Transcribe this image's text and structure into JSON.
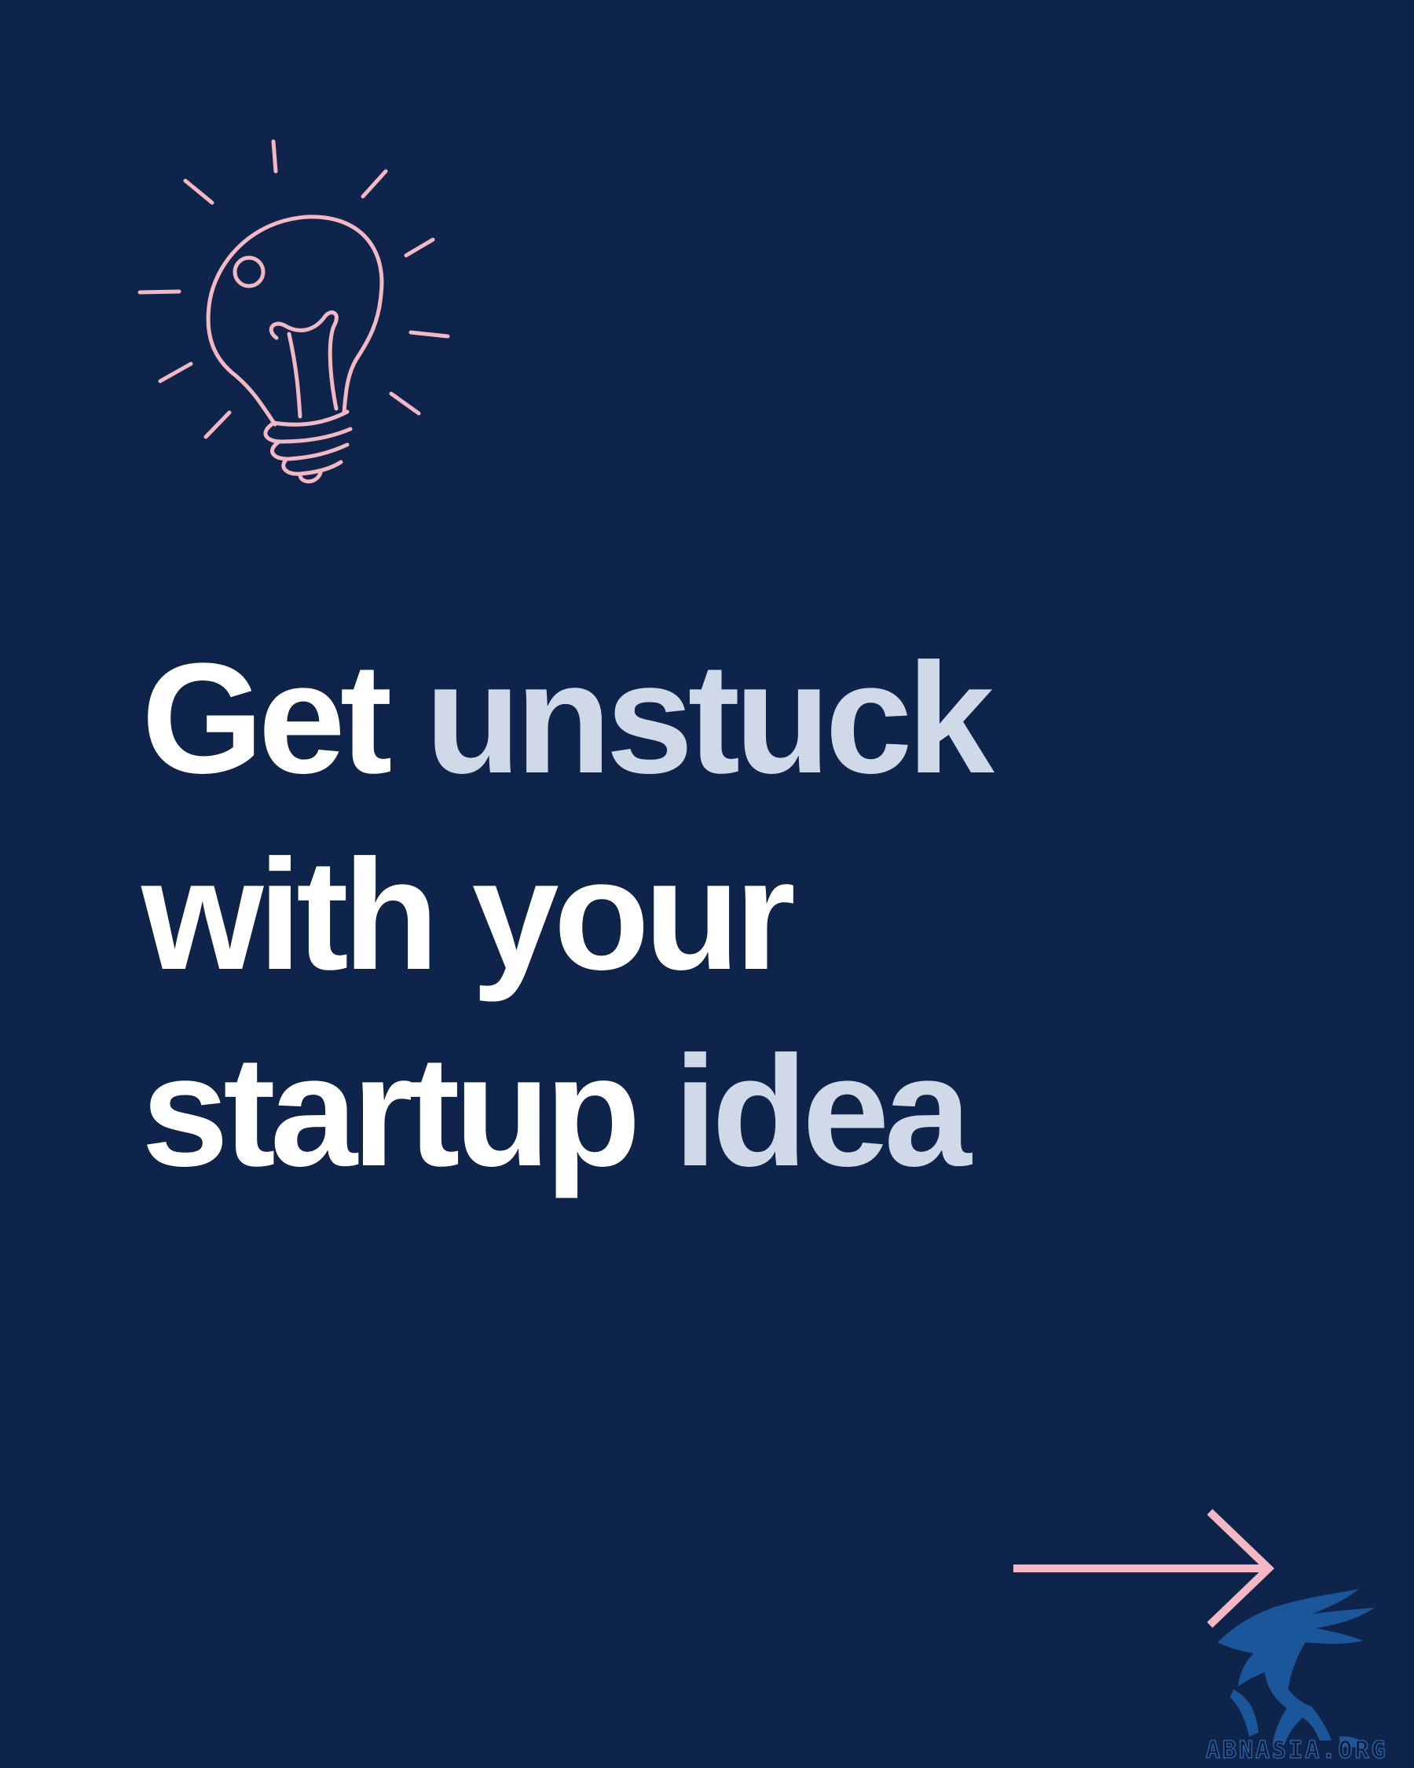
{
  "headline": {
    "line1": {
      "white": "Get",
      "accent": "unstuck"
    },
    "line2": {
      "white": "with your"
    },
    "line3": {
      "white": "startup",
      "accent": "idea"
    }
  },
  "watermark": {
    "text": "ABNASIA.ORG"
  },
  "colors": {
    "background": "#0e244b",
    "text_primary": "#ffffff",
    "text_accent": "#cfd9e8",
    "illustration": "#f4b8c4",
    "watermark": "#1f5fa8"
  },
  "icons": {
    "illustration": "lightbulb-icon",
    "navigation": "arrow-right-icon",
    "watermark_logo": "griffin-logo-icon"
  }
}
